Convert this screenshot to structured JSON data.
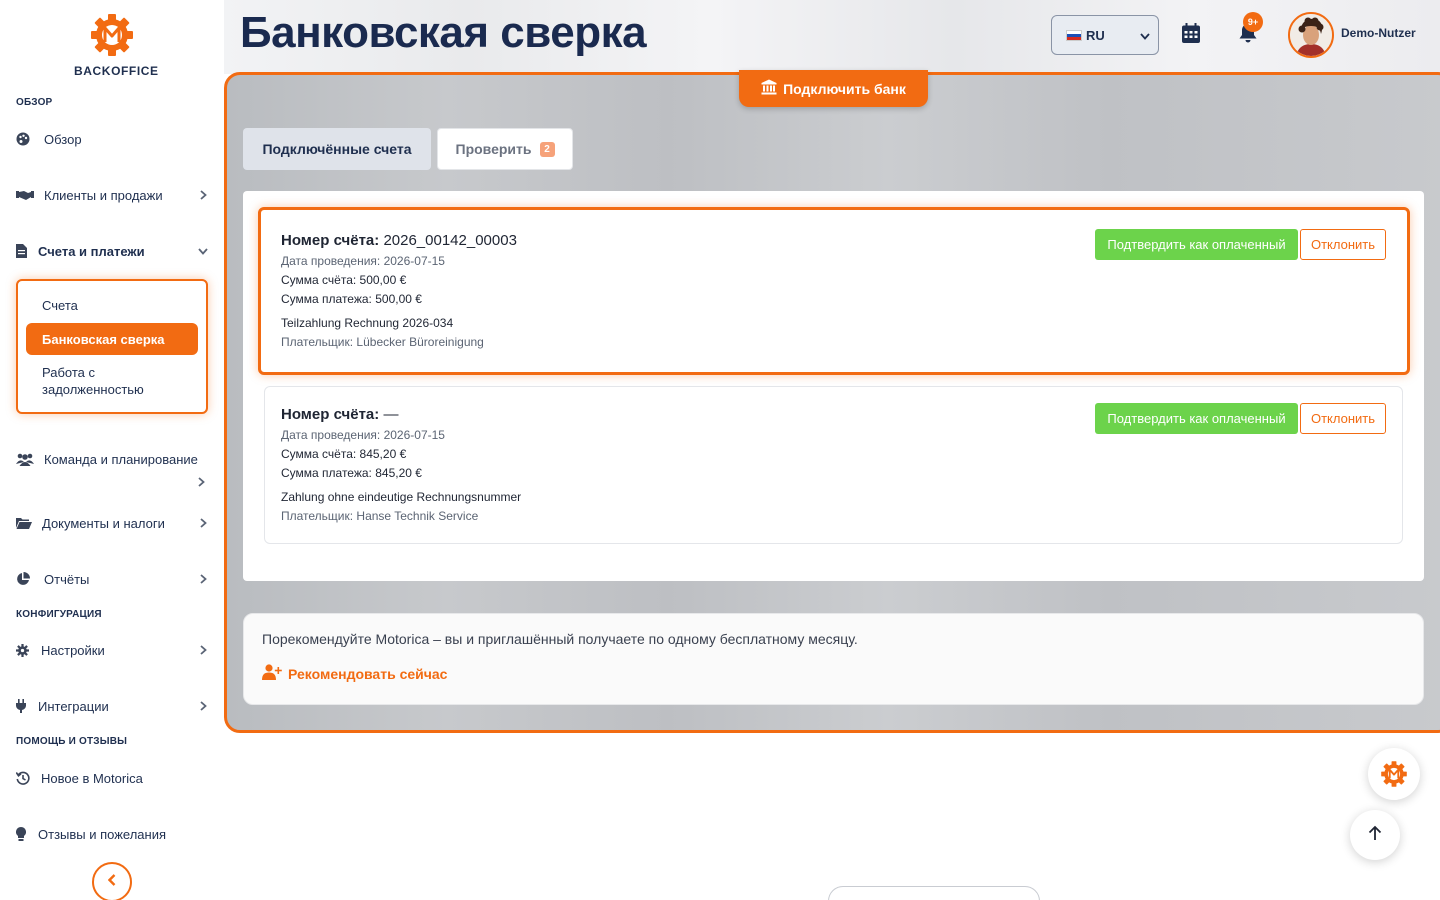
{
  "app": {
    "brand": "BACKOFFICE",
    "accent_color": "#f26b12",
    "confirm_color": "#6cd34b"
  },
  "header": {
    "title": "Банковская сверка",
    "language": "RU",
    "notification_count": "9+",
    "user_name": "Demo-Nutzer"
  },
  "sidebar": {
    "sections": {
      "overview": "ОБЗОР",
      "config": "КОНФИГУРАЦИЯ",
      "help": "ПОМОЩЬ И ОТЗЫВЫ"
    },
    "items": {
      "overview": "Обзор",
      "clients": "Клиенты и продажи",
      "invoices": "Счета и платежи",
      "team": "Команда и планирование",
      "documents": "Документы и налоги",
      "reports": "Отчёты",
      "settings": "Настройки",
      "integrations": "Интеграции",
      "news": "Новое в Motorica",
      "feedback": "Отзывы и пожелания"
    },
    "submenu": {
      "invoices": "Счета",
      "bank_reconciliation": "Банковская сверка",
      "debt_line1": "Работа с",
      "debt_line2": "задолженностью"
    }
  },
  "main": {
    "connect_bank": "Подключить банк",
    "tabs": {
      "connected": "Подключённые счета",
      "review": "Проверить",
      "review_count": "2"
    },
    "transactions": [
      {
        "invoice_label": "Номер счёта:",
        "invoice_number": "2026_00142_00003",
        "booking_date": "Дата проведения: 2026-07-15",
        "invoice_amount": "Сумма счёта: 500,00 €",
        "payment_amount": "Сумма платежа: 500,00 €",
        "reference": "Teilzahlung Rechnung 2026-034",
        "payer": "Плательщик: Lübecker Büroreinigung",
        "confirm": "Подтвердить как оплаченный",
        "reject": "Отклонить"
      },
      {
        "invoice_label": "Номер счёта:",
        "invoice_number": "—",
        "booking_date": "Дата проведения: 2026-07-15",
        "invoice_amount": "Сумма счёта: 845,20 €",
        "payment_amount": "Сумма платежа: 845,20 €",
        "reference": "Zahlung ohne eindeutige Rechnungsnummer",
        "payer": "Плательщик: Hanse Technik Service",
        "confirm": "Подтвердить как оплаченный",
        "reject": "Отклонить"
      }
    ],
    "referral": {
      "text": "Порекомендуйте Motorica – вы и приглашённый получаете по одному бесплатному месяцу.",
      "link": "Рекомендовать сейчас"
    }
  }
}
